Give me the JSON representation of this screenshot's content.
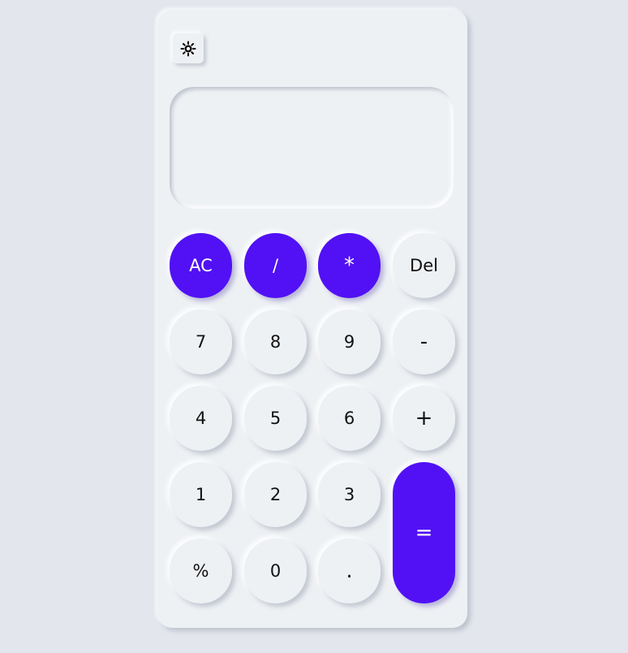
{
  "theme_toggle": {
    "icon": "sun-icon"
  },
  "display": {
    "previous": "",
    "current": ""
  },
  "keys": {
    "ac": "AC",
    "divide": "/",
    "multiply": "*",
    "delete": "Del",
    "seven": "7",
    "eight": "8",
    "nine": "9",
    "minus": "-",
    "four": "4",
    "five": "5",
    "six": "6",
    "plus": "+",
    "one": "1",
    "two": "2",
    "three": "3",
    "equals": "=",
    "percent": "%",
    "zero": "0",
    "decimal": "."
  },
  "colors": {
    "accent": "#5111f4",
    "surface": "#eef1f4",
    "background": "#e3e6ed"
  }
}
